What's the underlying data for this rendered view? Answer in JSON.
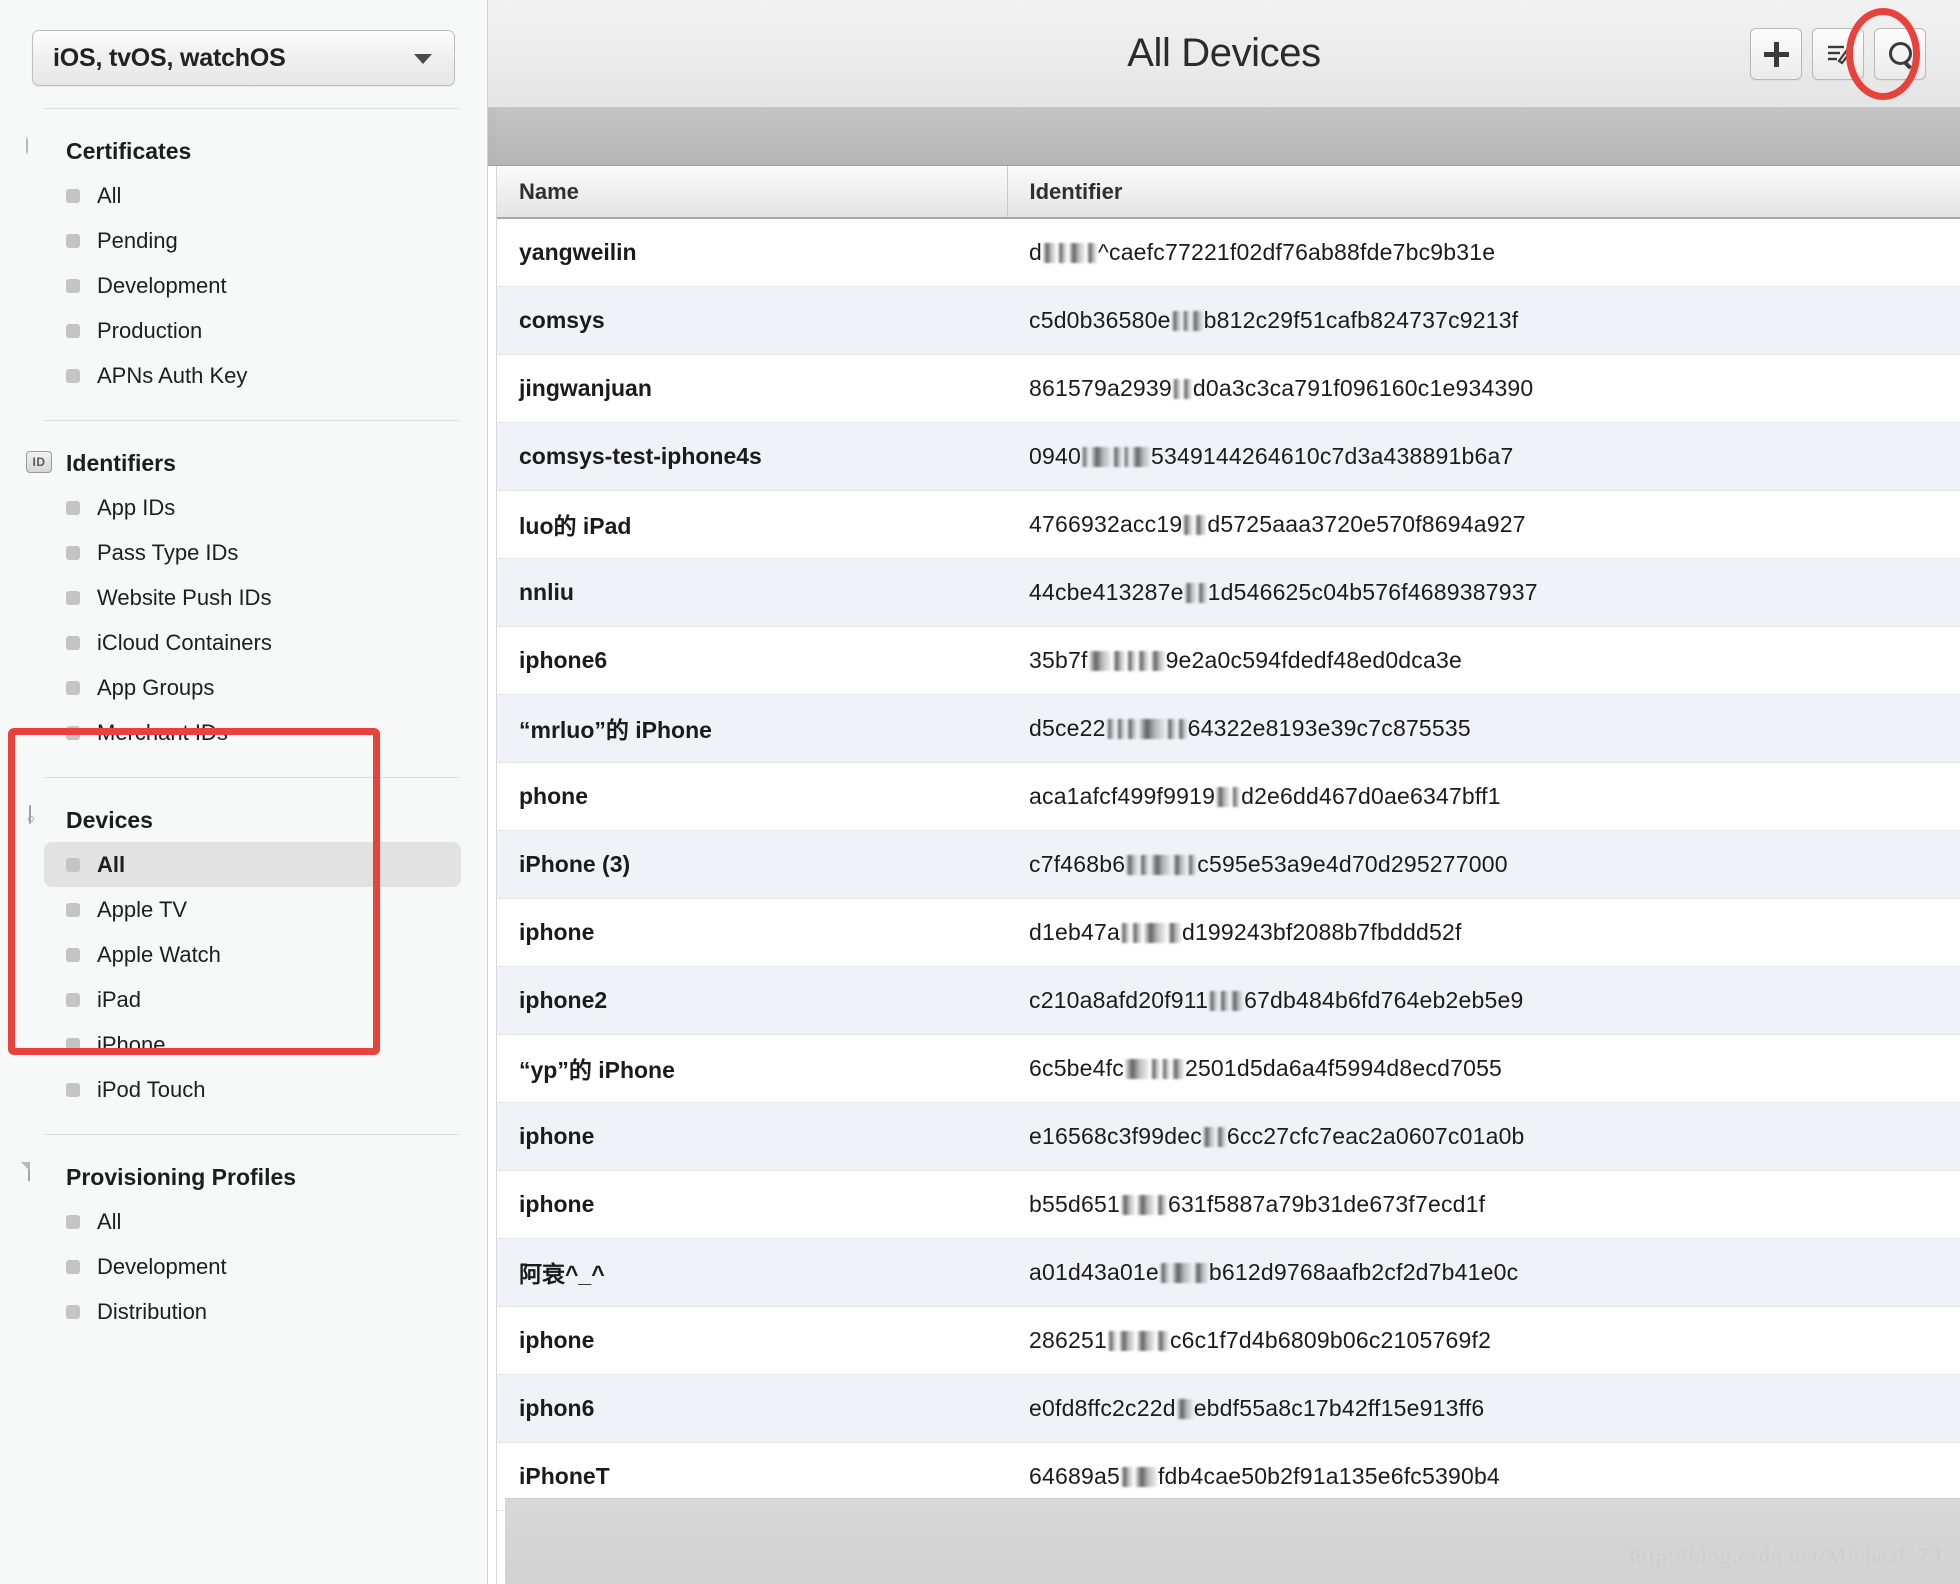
{
  "sidebar": {
    "os_selector": {
      "label": "iOS, tvOS, watchOS",
      "caret_icon": "chevron-down-icon"
    },
    "sections": [
      {
        "id": "certificates",
        "title": "Certificates",
        "icon": "certificate-rosette-icon",
        "items": [
          {
            "label": "All",
            "selected": false
          },
          {
            "label": "Pending",
            "selected": false
          },
          {
            "label": "Development",
            "selected": false
          },
          {
            "label": "Production",
            "selected": false
          },
          {
            "label": "APNs Auth Key",
            "selected": false
          }
        ]
      },
      {
        "id": "identifiers",
        "title": "Identifiers",
        "icon": "id-badge-icon",
        "items": [
          {
            "label": "App IDs",
            "selected": false
          },
          {
            "label": "Pass Type IDs",
            "selected": false
          },
          {
            "label": "Website Push IDs",
            "selected": false
          },
          {
            "label": "iCloud Containers",
            "selected": false
          },
          {
            "label": "App Groups",
            "selected": false
          },
          {
            "label": "Merchant IDs",
            "selected": false
          }
        ]
      },
      {
        "id": "devices",
        "title": "Devices",
        "icon": "device-phone-icon",
        "items": [
          {
            "label": "All",
            "selected": true
          },
          {
            "label": "Apple TV",
            "selected": false
          },
          {
            "label": "Apple Watch",
            "selected": false
          },
          {
            "label": "iPad",
            "selected": false
          },
          {
            "label": "iPhone",
            "selected": false
          },
          {
            "label": "iPod Touch",
            "selected": false
          }
        ]
      },
      {
        "id": "provisioning-profiles",
        "title": "Provisioning Profiles",
        "icon": "document-icon",
        "items": [
          {
            "label": "All",
            "selected": false
          },
          {
            "label": "Development",
            "selected": false
          },
          {
            "label": "Distribution",
            "selected": false
          }
        ]
      }
    ]
  },
  "topbar": {
    "title": "All Devices",
    "add_button": {
      "label": "+",
      "icon": "plus-icon"
    },
    "edit_button": {
      "icon": "edit-list-icon"
    },
    "search_button": {
      "icon": "search-icon"
    }
  },
  "annotations": {
    "highlight_color": "#e8423c",
    "plus_button_circle": "red-ellipse-around-add-button",
    "devices_section_box": "red-rectangle-around-devices-section"
  },
  "table": {
    "columns": [
      "Name",
      "Identifier"
    ],
    "rows": [
      {
        "name": "yangweilin",
        "id_pre": "d",
        "id_post": "^caefc77221f02df76ab88fde7bc9b31e",
        "mask_w": [
          13,
          9,
          16,
          10
        ]
      },
      {
        "name": "comsys",
        "id_pre": "c5d0b36580e",
        "id_post": "b812c29f51cafb824737c9213f",
        "mask_w": [
          9,
          7,
          11
        ]
      },
      {
        "name": "jingwanjuan",
        "id_pre": "861579a2939",
        "id_post": "d0a3c3ca791f096160c1e934390",
        "mask_w": [
          8,
          9
        ]
      },
      {
        "name": "comsys-test-iphone4s",
        "id_pre": "0940",
        "id_post": "5349144264610c7d3a438891b6a7",
        "mask_w": [
          7,
          20,
          9,
          6,
          18
        ]
      },
      {
        "name": "luo的 iPad",
        "id_pre": "4766932acc19",
        "id_post": "d5725aaa3720e570f8694a927",
        "mask_w": [
          10,
          11
        ]
      },
      {
        "name": "nnliu",
        "id_pre": "44cbe413287e",
        "id_post": "1d546625c04b576f4689387937",
        "mask_w": [
          11,
          9
        ]
      },
      {
        "name": "iphone6",
        "id_pre": "35b7f",
        "id_post": "9e2a0c594fdedf48ed0dca3e",
        "mask_w": [
          22,
          12,
          9,
          11,
          14
        ]
      },
      {
        "name": "“mrluo”的 iPhone",
        "id_pre": "d5ce22",
        "id_post": "64322e8193e39c7c875535",
        "mask_w": [
          8,
          8,
          10,
          26,
          9,
          9
        ]
      },
      {
        "name": "phone",
        "id_pre": "aca1afcf499f9919",
        "id_post": "d2e6dd467d0ae6347bff1",
        "mask_w": [
          14,
          8
        ]
      },
      {
        "name": "iPhone (3)",
        "id_pre": "c7f468b6",
        "id_post": "c595e53a9e4d70d295277000",
        "mask_w": [
          12,
          9,
          20,
          13,
          8
        ]
      },
      {
        "name": "iphone",
        "id_pre": "d1eb47a",
        "id_post": "d199243bf2088b7fbddd52f",
        "mask_w": [
          9,
          10,
          22,
          13
        ]
      },
      {
        "name": "iphone2",
        "id_pre": "c210a8afd20f911",
        "id_post": "67db484b6fd764eb2eb5e9",
        "mask_w": [
          9,
          9,
          12
        ]
      },
      {
        "name": "“yp”的 iPhone",
        "id_pre": "6c5be4fc",
        "id_post": "2501d5da6a4f5994d8ecd7055",
        "mask_w": [
          24,
          9,
          8,
          12
        ]
      },
      {
        "name": "iphone",
        "id_pre": "e16568c3f99dec",
        "id_post": "6cc27cfc7eac2a0607c01a0b",
        "mask_w": [
          12,
          9
        ]
      },
      {
        "name": "iphone",
        "id_pre": "b55d651",
        "id_post": "631f5887a79b31de673f7ecd1f",
        "mask_w": [
          14,
          18,
          10
        ]
      },
      {
        "name": "阿衰^_^",
        "id_pre": "a01d43a01e",
        "id_post": "b612d9768aafb2cf2d7b41e0c",
        "mask_w": [
          10,
          20,
          14
        ]
      },
      {
        "name": "iphone",
        "id_pre": "286251",
        "id_post": "c6c1f7d4b6809b06c2105769f2",
        "mask_w": [
          9,
          16,
          18,
          12
        ]
      },
      {
        "name": "iphon6",
        "id_pre": "e0fd8ffc2c22d",
        "id_post": "ebdf55a8c17b42ff15e913ff6",
        "mask_w": [
          16
        ]
      },
      {
        "name": "iPhoneT",
        "id_pre": "64689a5",
        "id_post": "fdb4cae50b2f91a135e6fc5390b4",
        "mask_w": [
          12,
          22
        ]
      }
    ]
  },
  "watermark": "http://blog.csdn.net/Micheal_ZJ"
}
